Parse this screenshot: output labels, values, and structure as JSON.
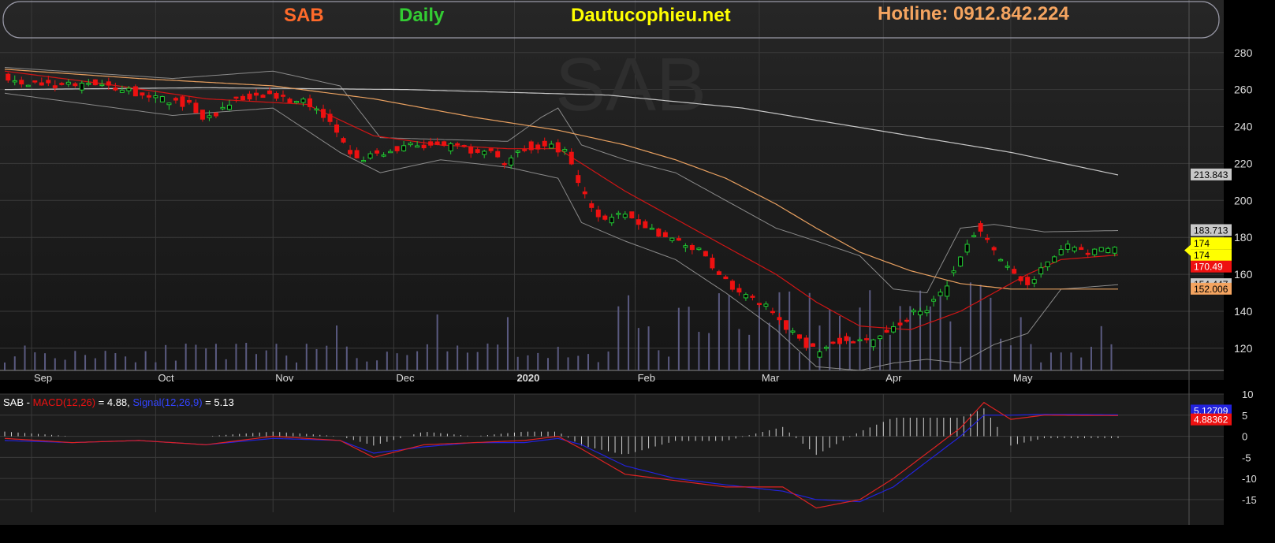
{
  "header": {
    "symbol": "SAB",
    "period": "Daily",
    "site": "Dautucophieu.net",
    "hotline": "Hotline: 0912.842.224"
  },
  "watermark": "SAB",
  "colors": {
    "background": "#000000",
    "panel": "#1a1a1a",
    "grid": "#3a3a3a",
    "up_candle": "#22cc33",
    "down_candle": "#ee1111",
    "bollinger": "#8a8a8a",
    "ma_short": "#d01515",
    "ma_mid": "#e8a060",
    "ma_long": "#c8c8c8",
    "volume": "#5a5a80",
    "macd": "#dd2222",
    "signal": "#2222dd",
    "symbol_text": "#ff6a2a",
    "period_text": "#33cc33",
    "site_text": "#ffff00",
    "hotline_text": "#f4a460"
  },
  "chart_data": [
    {
      "type": "candlestick",
      "name": "price",
      "x_labels": [
        "Sep",
        "Oct",
        "Nov",
        "Dec",
        "2020",
        "Feb",
        "Mar",
        "Apr",
        "May"
      ],
      "y_ticks": [
        120,
        140,
        160,
        180,
        200,
        220,
        240,
        260,
        280
      ],
      "ylim": [
        108,
        288
      ],
      "price_tags": [
        {
          "label": "213.843",
          "value": 213.843,
          "color": "#c8c8c8"
        },
        {
          "label": "183.713",
          "value": 183.713,
          "color": "#c8c8c8"
        },
        {
          "label": "174",
          "value": 176.6,
          "color": "#ffff00"
        },
        {
          "label": "174",
          "value": 170.2,
          "color": "#ffff00"
        },
        {
          "label": "170.49",
          "value": 164.0,
          "color": "#ee1111"
        },
        {
          "label": "154.447",
          "value": 154.447,
          "color": "#c8c8c8"
        },
        {
          "label": "152.006",
          "value": 152.006,
          "color": "#f4a460"
        }
      ],
      "close_anchors": [
        [
          0,
          266
        ],
        [
          10,
          263
        ],
        [
          20,
          262
        ],
        [
          30,
          263
        ],
        [
          40,
          258
        ],
        [
          55,
          252
        ],
        [
          60,
          243
        ],
        [
          70,
          256
        ],
        [
          80,
          257
        ],
        [
          92,
          252
        ],
        [
          98,
          240
        ],
        [
          105,
          222
        ],
        [
          112,
          225
        ],
        [
          120,
          230
        ],
        [
          135,
          229
        ],
        [
          145,
          225
        ],
        [
          150,
          220
        ],
        [
          155,
          229
        ],
        [
          162,
          230
        ],
        [
          168,
          225
        ],
        [
          172,
          205
        ],
        [
          178,
          190
        ],
        [
          185,
          192
        ],
        [
          192,
          185
        ],
        [
          200,
          178
        ],
        [
          208,
          172
        ],
        [
          212,
          160
        ],
        [
          220,
          150
        ],
        [
          228,
          142
        ],
        [
          235,
          128
        ],
        [
          242,
          118
        ],
        [
          250,
          125
        ],
        [
          258,
          123
        ],
        [
          265,
          130
        ],
        [
          270,
          138
        ],
        [
          275,
          142
        ],
        [
          280,
          150
        ],
        [
          285,
          170
        ],
        [
          290,
          185
        ],
        [
          295,
          172
        ],
        [
          300,
          162
        ],
        [
          305,
          155
        ],
        [
          310,
          165
        ],
        [
          315,
          175
        ],
        [
          320,
          174
        ],
        [
          325,
          172
        ],
        [
          332,
          174
        ]
      ],
      "bb_upper_anchors": [
        [
          0,
          272
        ],
        [
          50,
          266
        ],
        [
          80,
          270
        ],
        [
          100,
          262
        ],
        [
          112,
          234
        ],
        [
          130,
          233
        ],
        [
          150,
          232
        ],
        [
          160,
          245
        ],
        [
          165,
          250
        ],
        [
          172,
          230
        ],
        [
          185,
          222
        ],
        [
          200,
          215
        ],
        [
          215,
          200
        ],
        [
          230,
          185
        ],
        [
          242,
          178
        ],
        [
          255,
          170
        ],
        [
          265,
          152
        ],
        [
          275,
          150
        ],
        [
          285,
          185
        ],
        [
          295,
          187
        ],
        [
          310,
          183
        ],
        [
          332,
          183.7
        ]
      ],
      "bb_lower_anchors": [
        [
          0,
          258
        ],
        [
          50,
          246
        ],
        [
          80,
          250
        ],
        [
          100,
          226
        ],
        [
          112,
          215
        ],
        [
          130,
          222
        ],
        [
          150,
          218
        ],
        [
          165,
          212
        ],
        [
          172,
          188
        ],
        [
          185,
          178
        ],
        [
          200,
          168
        ],
        [
          215,
          150
        ],
        [
          230,
          130
        ],
        [
          242,
          110
        ],
        [
          255,
          108
        ],
        [
          265,
          112
        ],
        [
          275,
          114
        ],
        [
          285,
          112
        ],
        [
          295,
          122
        ],
        [
          305,
          128
        ],
        [
          315,
          152
        ],
        [
          332,
          154.4
        ]
      ],
      "ma_short_anchors": [
        [
          0,
          270
        ],
        [
          30,
          263
        ],
        [
          60,
          255
        ],
        [
          90,
          252
        ],
        [
          110,
          235
        ],
        [
          130,
          230
        ],
        [
          150,
          228
        ],
        [
          165,
          228
        ],
        [
          172,
          220
        ],
        [
          185,
          205
        ],
        [
          200,
          190
        ],
        [
          215,
          175
        ],
        [
          230,
          160
        ],
        [
          242,
          145
        ],
        [
          255,
          132
        ],
        [
          270,
          130
        ],
        [
          285,
          140
        ],
        [
          295,
          150
        ],
        [
          305,
          160
        ],
        [
          315,
          168
        ],
        [
          332,
          170.5
        ]
      ],
      "ma_mid_anchors": [
        [
          0,
          271
        ],
        [
          40,
          266
        ],
        [
          80,
          262
        ],
        [
          110,
          255
        ],
        [
          140,
          245
        ],
        [
          165,
          238
        ],
        [
          185,
          230
        ],
        [
          200,
          222
        ],
        [
          215,
          212
        ],
        [
          230,
          198
        ],
        [
          242,
          185
        ],
        [
          255,
          172
        ],
        [
          270,
          162
        ],
        [
          285,
          155
        ],
        [
          300,
          152
        ],
        [
          315,
          152
        ],
        [
          332,
          152
        ]
      ],
      "ma_long_anchors": [
        [
          0,
          260
        ],
        [
          60,
          261
        ],
        [
          120,
          260
        ],
        [
          180,
          257
        ],
        [
          220,
          250
        ],
        [
          260,
          238
        ],
        [
          300,
          226
        ],
        [
          332,
          213.8
        ]
      ]
    },
    {
      "type": "line",
      "name": "macd",
      "legend": {
        "prefix": "SAB - ",
        "macd_label": "MACD(12,26)",
        "macd_value": " = 4.88, ",
        "signal_label": "Signal(12,26,9)",
        "signal_value": " = 5.13"
      },
      "y_ticks": [
        10,
        5,
        0,
        -5,
        -10,
        -15
      ],
      "ylim": [
        -18,
        10
      ],
      "value_tags": [
        {
          "label": "5.12709",
          "value": 6.0,
          "color": "#2222dd"
        },
        {
          "label": "4.88362",
          "value": 3.9,
          "color": "#ee1111"
        }
      ],
      "macd_anchors": [
        [
          0,
          -0.5
        ],
        [
          20,
          -1.5
        ],
        [
          40,
          -1
        ],
        [
          60,
          -2
        ],
        [
          80,
          0
        ],
        [
          100,
          -1
        ],
        [
          110,
          -5
        ],
        [
          125,
          -2
        ],
        [
          140,
          -1.5
        ],
        [
          155,
          -1
        ],
        [
          165,
          0
        ],
        [
          172,
          -3
        ],
        [
          185,
          -9
        ],
        [
          200,
          -10.5
        ],
        [
          215,
          -12
        ],
        [
          232,
          -12
        ],
        [
          242,
          -17
        ],
        [
          255,
          -15
        ],
        [
          265,
          -10
        ],
        [
          275,
          -4
        ],
        [
          285,
          2
        ],
        [
          292,
          8
        ],
        [
          300,
          4
        ],
        [
          310,
          5
        ],
        [
          332,
          4.9
        ]
      ],
      "signal_anchors": [
        [
          0,
          -1
        ],
        [
          20,
          -1.5
        ],
        [
          40,
          -1
        ],
        [
          60,
          -2
        ],
        [
          80,
          -0.5
        ],
        [
          100,
          -1
        ],
        [
          110,
          -4
        ],
        [
          125,
          -2.5
        ],
        [
          140,
          -1.5
        ],
        [
          155,
          -1.5
        ],
        [
          165,
          -0.5
        ],
        [
          172,
          -2
        ],
        [
          185,
          -7
        ],
        [
          200,
          -10
        ],
        [
          215,
          -11.5
        ],
        [
          232,
          -13
        ],
        [
          242,
          -15
        ],
        [
          255,
          -15.5
        ],
        [
          265,
          -12
        ],
        [
          275,
          -6
        ],
        [
          285,
          0
        ],
        [
          292,
          5
        ],
        [
          300,
          5
        ],
        [
          310,
          5.2
        ],
        [
          332,
          5.1
        ]
      ]
    }
  ]
}
